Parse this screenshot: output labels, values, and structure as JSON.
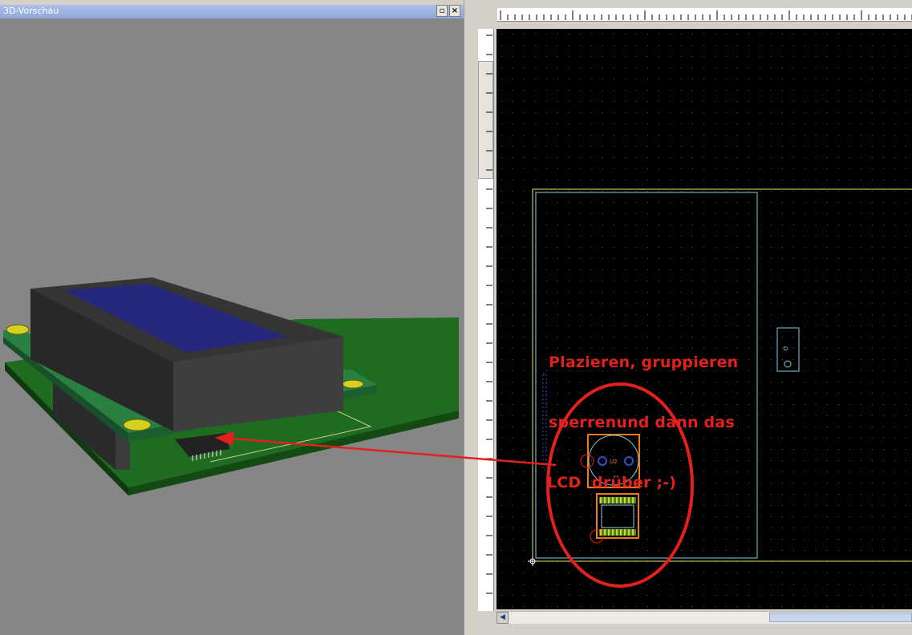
{
  "preview": {
    "title": "3D-Vorschau",
    "restore_glyph": "▫",
    "close_glyph": "×"
  },
  "editor": {
    "component_ref": "U2",
    "footprint_label": "Ω",
    "scroll_left_glyph": "◀"
  },
  "annotation": {
    "lines": [
      "Plazieren, gruppieren",
      "sperrenund dann das",
      "LCD  drüber ;-)"
    ],
    "color": "#e3211c"
  },
  "colors": {
    "pcb_green": "#1e6b1e",
    "board_outline": "#e8e86a",
    "silkscreen_cyan": "#7fd0e0",
    "pad_orange": "#ee7a1a",
    "lcd_blue": "#25287a"
  }
}
